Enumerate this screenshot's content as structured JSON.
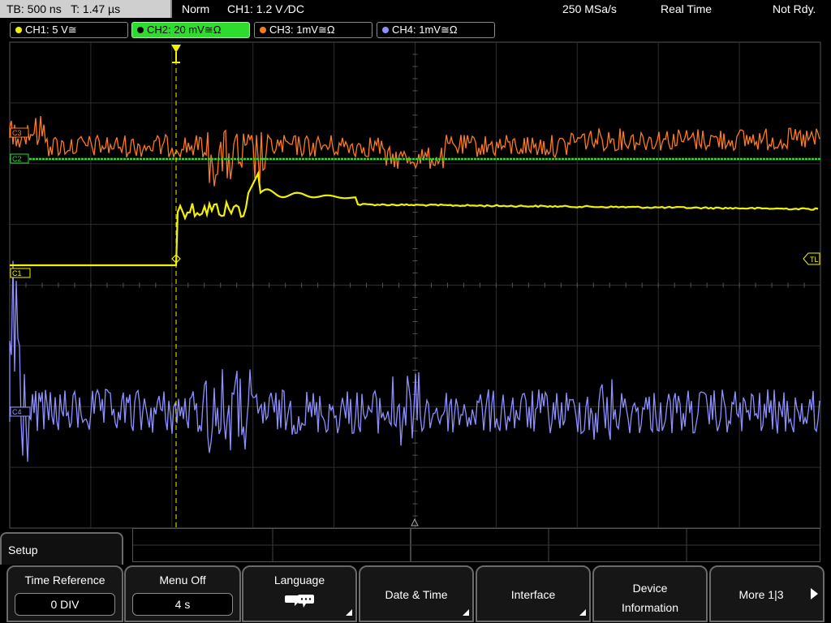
{
  "status_bar": {
    "timebase": "TB: 500 ns",
    "trigger_time": "T: 1.47 µs",
    "trigger_mode": "Norm",
    "trigger_setting": "CH1: 1.2 V ⁄DC",
    "sample_rate": "250 MSa/s",
    "acq_mode": "Real Time",
    "state": "Not Rdy."
  },
  "channels": [
    {
      "label": "CH1: 5 V≅",
      "color": "#f2f200",
      "active": false
    },
    {
      "label": "CH2: 20 mV≅Ω",
      "color": "#2ddc2d",
      "active": true
    },
    {
      "label": "CH3: 1mV≅Ω",
      "color": "#ff7a1a",
      "active": false
    },
    {
      "label": "CH4: 1mV≅Ω",
      "color": "#8f8fff",
      "active": false
    }
  ],
  "markers": {
    "trigger_level": "TL",
    "ch1_marker": "C1",
    "ch2_marker": "C2",
    "ch3_marker": "C3",
    "ch4_marker": "C4"
  },
  "menu": {
    "title": "Setup",
    "time_reference": {
      "label": "Time Reference",
      "value": "0 DIV"
    },
    "menu_off": {
      "label": "Menu Off",
      "value": "4 s"
    },
    "language": {
      "label": "Language",
      "icon": "speech-bubbles-icon"
    },
    "date_time": {
      "label": "Date & Time"
    },
    "interface": {
      "label": "Interface"
    },
    "device_info": {
      "line1": "Device",
      "line2": "Information"
    },
    "more": {
      "label": "More 1|3"
    }
  },
  "colors": {
    "ch1": "#f2f200",
    "ch2": "#2ddc2d",
    "ch3": "#ff7a1a",
    "ch4": "#8f8fff",
    "grid": "#3a3a3a"
  }
}
